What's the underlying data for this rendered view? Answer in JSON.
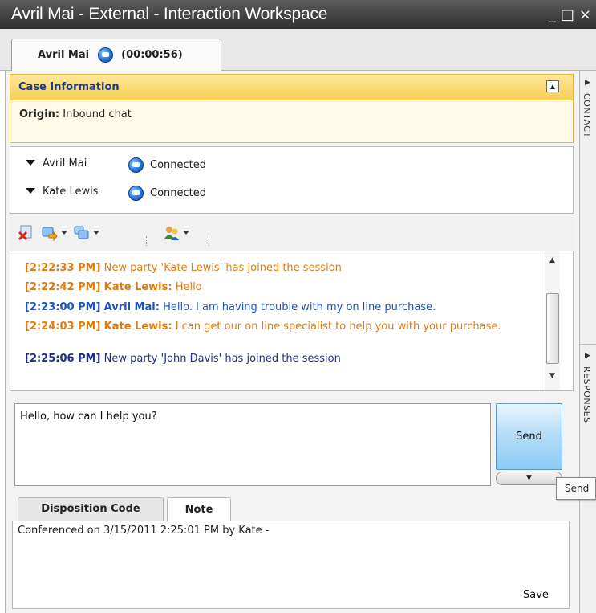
{
  "window": {
    "title": "Avril Mai - External - Interaction Workspace",
    "controls": [
      "_",
      "□",
      "×"
    ]
  },
  "session_tab": {
    "name": "Avril Mai",
    "timer": "(00:00:56)",
    "icon": "chat-icon"
  },
  "side_panel": {
    "items": [
      "CONTACT",
      "RESPONSES"
    ]
  },
  "case_info": {
    "header": "Case Information",
    "origin_label": "Origin:",
    "origin_value": "Inbound chat"
  },
  "parties": [
    {
      "name": "Avril Mai",
      "status": "Connected"
    },
    {
      "name": "Kate Lewis",
      "status": "Connected"
    }
  ],
  "toolbar": {
    "icons": [
      "end-chat-icon",
      "transfer-icon",
      "conference-icon",
      "consult-icon"
    ]
  },
  "transcript": {
    "messages": [
      {
        "time": "[2:22:33 PM]",
        "sender": "",
        "text": "New party 'Kate Lewis' has joined the session"
      },
      {
        "time": "[2:22:42 PM]",
        "sender": "Kate Lewis:",
        "text": "Hello"
      },
      {
        "time": "[2:23:00 PM]",
        "sender": "Avril Mai:",
        "text": "Hello. I am having trouble with my on line purchase."
      },
      {
        "time": "[2:24:03 PM]",
        "sender": "Kate Lewis:",
        "text": "I can get our on line specialist to help you with your purchase."
      },
      {
        "time": "[2:25:06 PM]",
        "sender": "",
        "text": "New party 'John Davis' has joined the session"
      }
    ]
  },
  "composer": {
    "value": "Hello, how can I help you?",
    "send_label": "Send",
    "tooltip": "Send"
  },
  "bottom_tabs": {
    "tabs": [
      "Disposition Code",
      "Note"
    ],
    "active": "Note"
  },
  "note": {
    "text": "Conferenced on 3/15/2011 2:25:01 PM by Kate -",
    "save_label": "Save"
  },
  "colors": {
    "agent": "#e07b0e",
    "customer": "#1a53c2",
    "system_time": "#1e2f88",
    "case_header": "#f7cf56"
  }
}
